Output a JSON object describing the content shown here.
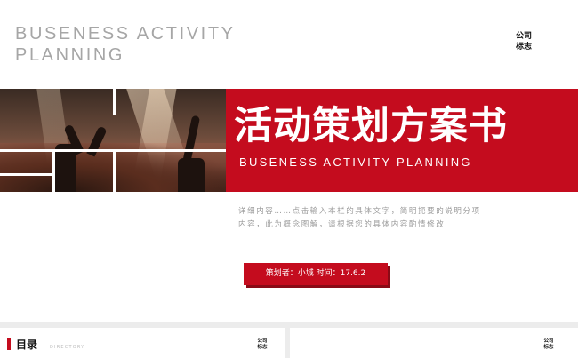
{
  "header": {
    "title_en_line1": "BUSENESS ACTIVITY",
    "title_en_line2": "PLANNING",
    "logo_line1": "公司",
    "logo_line2": "标志"
  },
  "hero": {
    "title_cn": "活动策划方案书",
    "subtitle_en": "BUSENESS ACTIVITY PLANNING"
  },
  "description": {
    "line1": "详细内容……点击输入本栏的具体文字，简明扼要的说明分项",
    "line2": "内容，此为概念图解，请根据您的具体内容酌情修改"
  },
  "badge": {
    "text": "策划者：小城  时间：17.6.2"
  },
  "thumbnails": {
    "toc_title": "目录",
    "toc_subtitle": "DIRECTORY",
    "logo_line1": "公司",
    "logo_line2": "标志"
  },
  "colors": {
    "accent": "#c40c1e",
    "title_gray": "#a6a6a6"
  }
}
